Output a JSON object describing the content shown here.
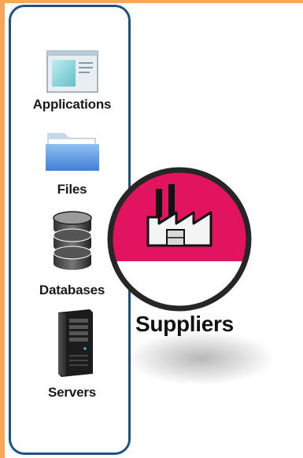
{
  "items": [
    {
      "label": "Applications",
      "icon": "application-window-icon"
    },
    {
      "label": "Files",
      "icon": "folder-icon"
    },
    {
      "label": "Databases",
      "icon": "database-icon"
    },
    {
      "label": "Servers",
      "icon": "server-icon"
    }
  ],
  "supplier": {
    "label": "Suppliers",
    "icon": "factory-icon"
  },
  "colors": {
    "frame": "#f7a75a",
    "panel_border": "#1c5384",
    "supplier_fill": "#e3145f",
    "supplier_ring": "#222222"
  }
}
